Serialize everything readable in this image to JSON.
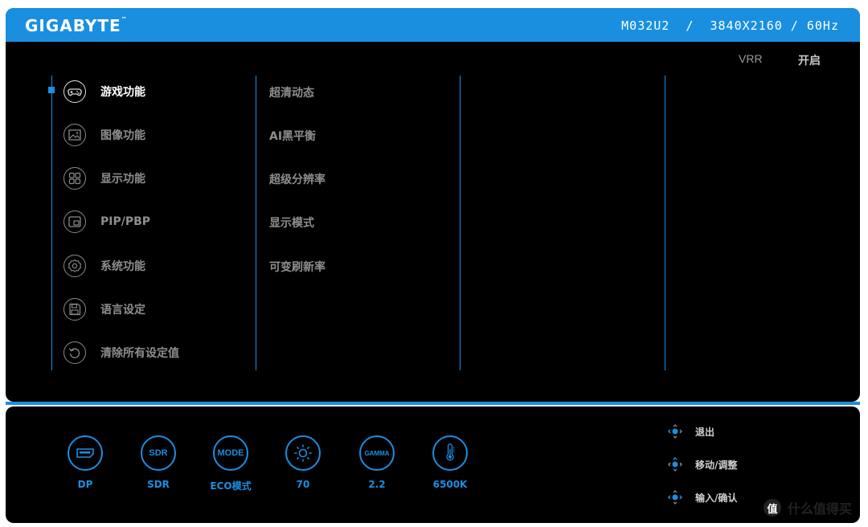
{
  "header": {
    "brand": "GIGABYTE",
    "trademark": "™",
    "model_info": "M032U2  /  3840X2160 / 60Hz"
  },
  "status": {
    "label": "VRR",
    "value": "开启"
  },
  "menu": [
    {
      "label": "游戏功能",
      "icon": "gamepad-icon",
      "active": true
    },
    {
      "label": "图像功能",
      "icon": "image-icon"
    },
    {
      "label": "显示功能",
      "icon": "display-grid-icon"
    },
    {
      "label": "PIP/PBP",
      "icon": "pip-icon"
    },
    {
      "label": "系统功能",
      "icon": "gear-icon"
    },
    {
      "label": "语言设定",
      "icon": "save-icon"
    },
    {
      "label": "清除所有设定值",
      "icon": "reset-icon"
    }
  ],
  "submenu": [
    "超清动态",
    "AI黑平衡",
    "超级分辨率",
    "显示模式",
    "可变刷新率"
  ],
  "bottom_status": [
    {
      "icon_text": "",
      "icon": "dp-port-icon",
      "caption": "DP"
    },
    {
      "icon_text": "SDR",
      "icon": "sdr-icon",
      "caption": "SDR"
    },
    {
      "icon_text": "MODE",
      "icon": "mode-icon",
      "caption": "ECO模式"
    },
    {
      "icon_text": "",
      "icon": "brightness-icon",
      "caption": "70"
    },
    {
      "icon_text": "GAMMA",
      "icon": "gamma-icon",
      "caption": "2.2"
    },
    {
      "icon_text": "",
      "icon": "thermometer-icon",
      "caption": "6500K"
    }
  ],
  "nav_hints": [
    {
      "label": "退出",
      "icon": "joystick-left-icon"
    },
    {
      "label": "移动/调整",
      "icon": "joystick-updown-icon"
    },
    {
      "label": "输入/确认",
      "icon": "joystick-press-icon"
    }
  ],
  "watermark": {
    "logo": "值",
    "text": "什么值得买"
  },
  "colors": {
    "accent": "#1a8fe0",
    "background": "#000000",
    "text_active": "#ffffff",
    "text_inactive": "#8e8e8e"
  }
}
